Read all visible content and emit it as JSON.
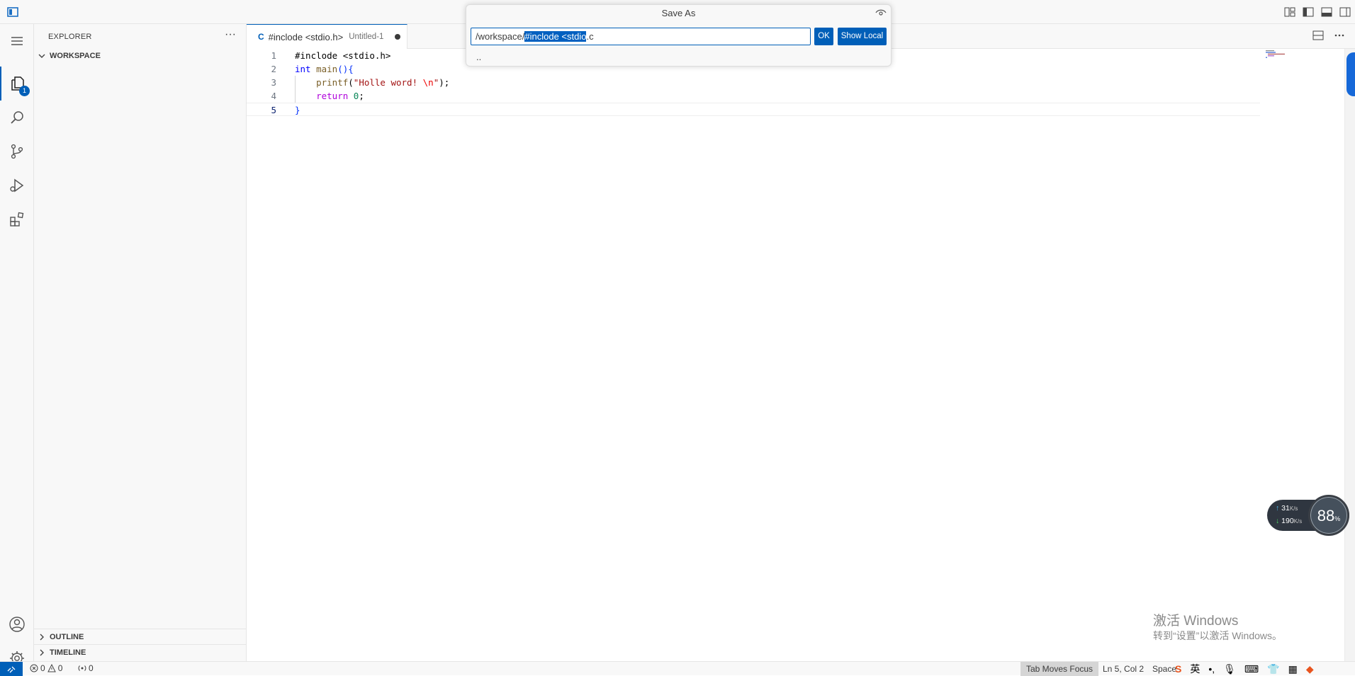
{
  "saveas": {
    "title": "Save As",
    "input_prefix": "/workspace/",
    "input_selected": "#inclode <stdio",
    "input_suffix": ".c",
    "ok_label": "OK",
    "show_local_label": "Show Local",
    "parent_item": ".."
  },
  "activity": {
    "explorer_badge": "1"
  },
  "sidebar": {
    "header": "EXPLORER",
    "more": "···",
    "workspace": "WORKSPACE",
    "outline": "OUTLINE",
    "timeline": "TIMELINE"
  },
  "tab": {
    "lang": "C",
    "title": "#inclode <stdio.h>",
    "description": "Untitled-1"
  },
  "editor": {
    "lines": [
      {
        "num": "1",
        "tokens": [
          {
            "t": "#inclode <stdio.h>",
            "c": "pp"
          }
        ]
      },
      {
        "num": "2",
        "tokens": [
          {
            "t": "int",
            "c": "kw"
          },
          {
            "t": " ",
            "c": "punc"
          },
          {
            "t": "main",
            "c": "fn"
          },
          {
            "t": "(){",
            "c": "brace-y"
          }
        ]
      },
      {
        "num": "3",
        "tokens": [
          {
            "t": "    ",
            "c": "punc"
          },
          {
            "t": "printf",
            "c": "fn"
          },
          {
            "t": "(",
            "c": "punc"
          },
          {
            "t": "\"Holle word! ",
            "c": "str"
          },
          {
            "t": "\\n",
            "c": "esc"
          },
          {
            "t": "\"",
            "c": "str"
          },
          {
            "t": ");",
            "c": "punc"
          }
        ]
      },
      {
        "num": "4",
        "tokens": [
          {
            "t": "    ",
            "c": "punc"
          },
          {
            "t": "return",
            "c": "ctl"
          },
          {
            "t": " ",
            "c": "punc"
          },
          {
            "t": "0",
            "c": "num"
          },
          {
            "t": ";",
            "c": "punc"
          }
        ]
      },
      {
        "num": "5",
        "tokens": [
          {
            "t": "}",
            "c": "brace-y"
          }
        ]
      }
    ],
    "current_line": "5"
  },
  "statusbar": {
    "errors": "0",
    "warnings": "0",
    "ports": "0",
    "tab_moves_focus": "Tab Moves Focus",
    "position": "Ln 5, Col 2",
    "spaces": "Space",
    "tray_ime": "英"
  },
  "net_widget": {
    "up": "31",
    "down": "190",
    "unit": "K/s",
    "percent": "88",
    "percent_sign": "%"
  },
  "watermark": {
    "line1": "激活 Windows",
    "line2": "转到“设置”以激活 Windows。"
  },
  "colors": {
    "accent": "#005fb8",
    "selection": "#0060c0"
  }
}
